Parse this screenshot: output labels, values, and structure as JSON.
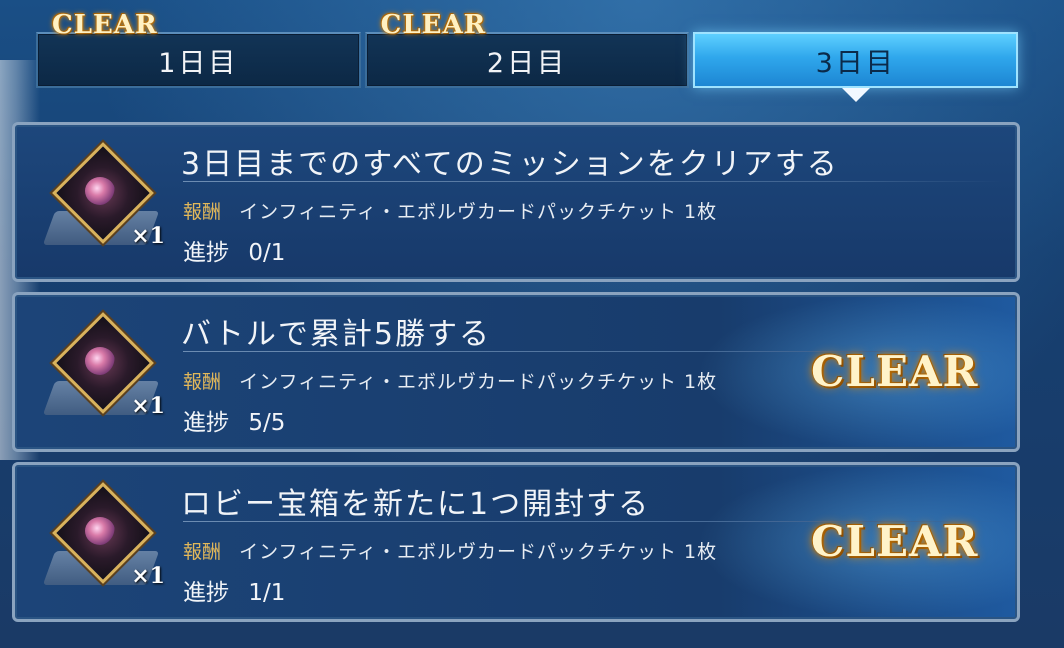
{
  "tabs": [
    {
      "label": "1日目",
      "badge": "CLEAR",
      "active": false
    },
    {
      "label": "2日目",
      "badge": "CLEAR",
      "active": false
    },
    {
      "label": "3日目",
      "badge": "",
      "active": true
    }
  ],
  "reward_label": "報酬",
  "progress_label": "進捗",
  "missions": [
    {
      "title": "3日目までのすべてのミッションをクリアする",
      "reward": "インフィニティ・エボルヴカードパックチケット 1枚",
      "progress": "0/1",
      "quantity": "×1",
      "status": "",
      "reward_icon": "evolve-card-pack-ticket-icon"
    },
    {
      "title": "バトルで累計5勝する",
      "reward": "インフィニティ・エボルヴカードパックチケット 1枚",
      "progress": "5/5",
      "quantity": "×1",
      "status": "CLEAR",
      "reward_icon": "evolve-card-pack-ticket-icon"
    },
    {
      "title": "ロビー宝箱を新たに1つ開封する",
      "reward": "インフィニティ・エボルヴカードパックチケット 1枚",
      "progress": "1/1",
      "quantity": "×1",
      "status": "CLEAR",
      "reward_icon": "evolve-card-pack-ticket-icon"
    }
  ],
  "colors": {
    "accent_gold": "#e2b85a",
    "active_tab": "#2fa7ec",
    "card_bg": "#1d477c"
  }
}
